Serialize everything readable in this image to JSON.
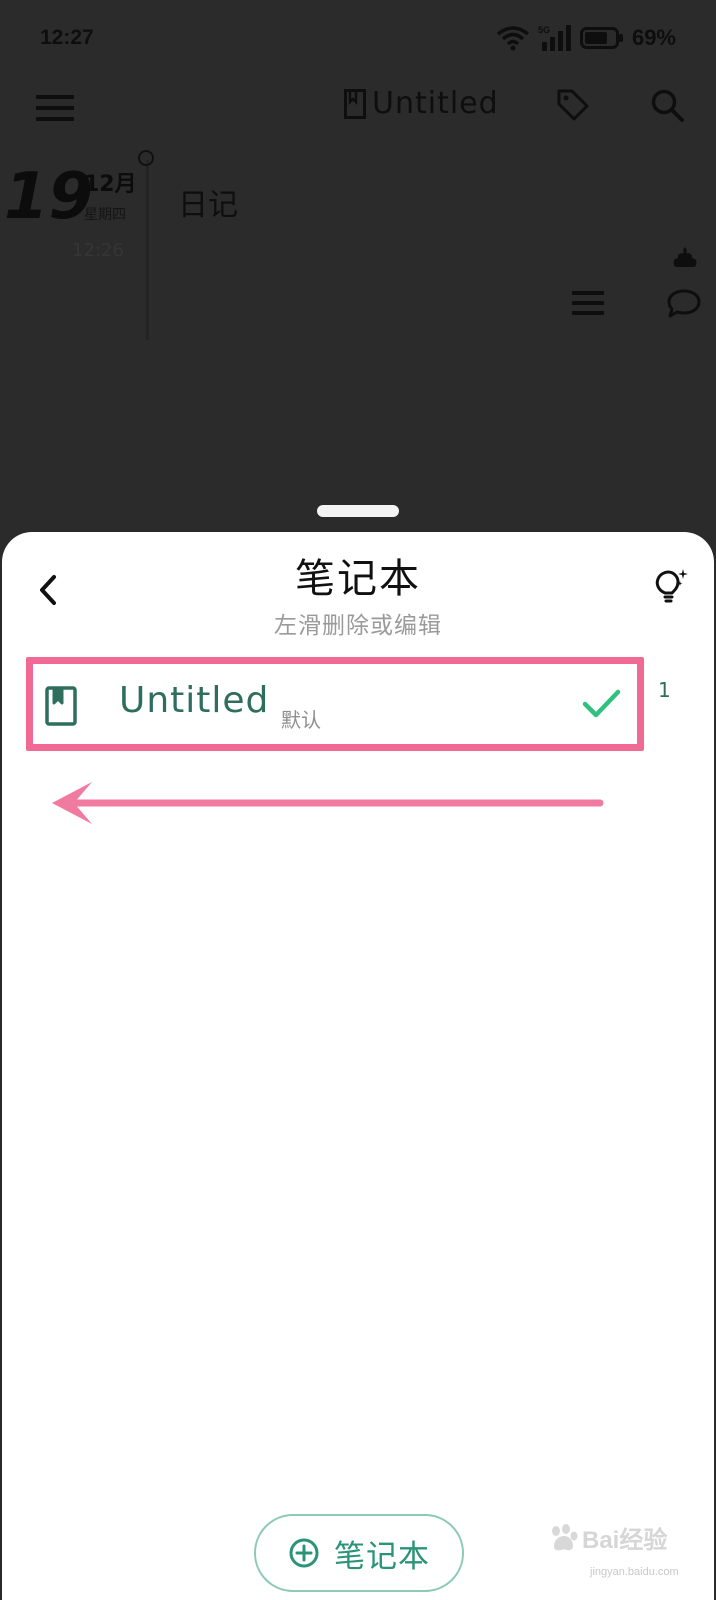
{
  "status_bar": {
    "time": "12:27",
    "network": "5G",
    "battery": "69%"
  },
  "background": {
    "notebook_title": "Untitled",
    "date": {
      "day": "19",
      "month": "12月",
      "weekday": "星期四",
      "time": "12:26"
    },
    "entry_title": "日记"
  },
  "sheet": {
    "title": "笔记本",
    "subtitle": "左滑删除或编辑",
    "notebooks": [
      {
        "title": "Untitled",
        "badge": "默认",
        "selected": true,
        "count": "1"
      }
    ],
    "add_button_label": "笔记本"
  },
  "colors": {
    "accent": "#2b9478",
    "highlight": "#f06a94",
    "check": "#2ec27e"
  },
  "watermark": {
    "text": "Bai经验",
    "sub": "jingyan.baidu.com"
  }
}
